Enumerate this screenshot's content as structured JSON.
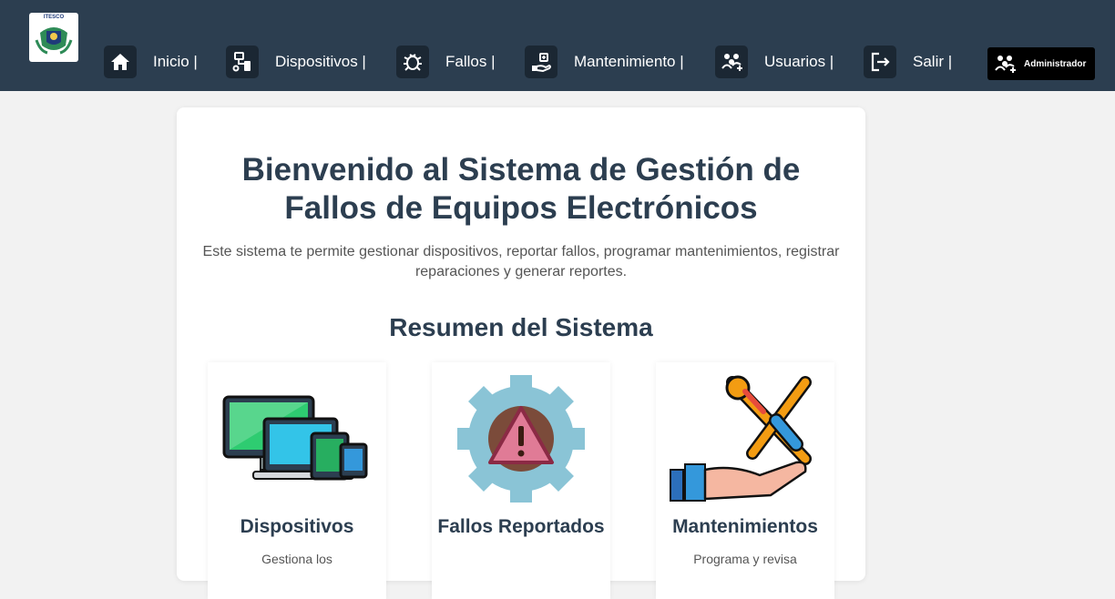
{
  "logo": {
    "text": "ITESCO"
  },
  "nav": {
    "items": [
      {
        "label": "Inicio |",
        "icon": "home-icon"
      },
      {
        "label": "Dispositivos |",
        "icon": "devices-icon"
      },
      {
        "label": "Fallos |",
        "icon": "bug-icon"
      },
      {
        "label": "Mantenimiento |",
        "icon": "maintenance-icon"
      },
      {
        "label": "Usuarios |",
        "icon": "users-icon"
      },
      {
        "label": "Salir |",
        "icon": "logout-icon"
      }
    ],
    "user_badge": {
      "label": "Administrador",
      "icon": "users-icon"
    }
  },
  "main": {
    "title": "Bienvenido al Sistema de Gestión de Fallos de Equipos Electrónicos",
    "description": "Este sistema te permite gestionar dispositivos, reportar fallos, programar mantenimientos, registrar reparaciones y generar reportes.",
    "summary_title": "Resumen del Sistema",
    "cards": [
      {
        "title": "Dispositivos",
        "description": "Gestiona los",
        "icon": "devices-illustration"
      },
      {
        "title": "Fallos Reportados",
        "description": "",
        "icon": "warning-gear-illustration"
      },
      {
        "title": "Mantenimientos",
        "description": "Programa y revisa",
        "icon": "tools-hand-illustration"
      }
    ]
  },
  "colors": {
    "navbar": "#2c3e50",
    "background": "#f2f2f2",
    "title": "#2c3e50",
    "text": "#555555"
  }
}
